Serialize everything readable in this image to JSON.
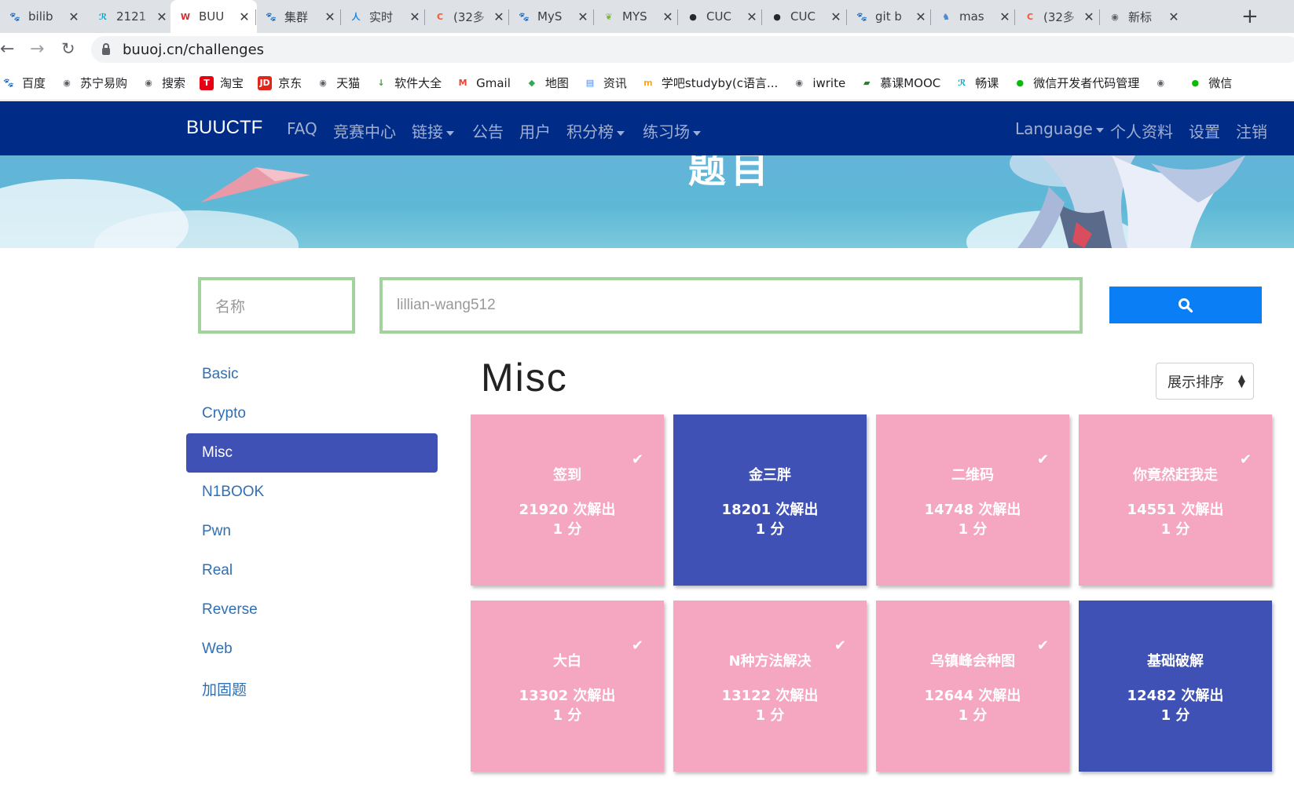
{
  "browser": {
    "tabs": [
      {
        "title": "bilib",
        "icon": "baidu-icon",
        "color": "#2932e1",
        "glyph": "🐾"
      },
      {
        "title": "2121",
        "icon": "runner-icon",
        "color": "#00a3c4",
        "glyph": "ℛ"
      },
      {
        "title": "BUU",
        "icon": "buuctf-icon",
        "color": "#d32f2f",
        "glyph": "W"
      },
      {
        "title": "集群",
        "icon": "baidu-icon",
        "color": "#2932e1",
        "glyph": "🐾"
      },
      {
        "title": "实时",
        "icon": "renren-icon",
        "color": "#1e88e5",
        "glyph": "人"
      },
      {
        "title": "(32多",
        "icon": "csdn-icon",
        "color": "#fc5531",
        "glyph": "C"
      },
      {
        "title": "MyS",
        "icon": "baidu-icon",
        "color": "#2932e1",
        "glyph": "🐾"
      },
      {
        "title": "MYS",
        "icon": "leaf-icon",
        "color": "#7cb342",
        "glyph": "❦"
      },
      {
        "title": "CUC",
        "icon": "github-icon",
        "color": "#24292e",
        "glyph": "●"
      },
      {
        "title": "CUC",
        "icon": "github-icon",
        "color": "#24292e",
        "glyph": "●"
      },
      {
        "title": "git b",
        "icon": "baidu-icon",
        "color": "#2932e1",
        "glyph": "🐾"
      },
      {
        "title": "mas",
        "icon": "elephant-icon",
        "color": "#4a86c5",
        "glyph": "♞"
      },
      {
        "title": "(32多",
        "icon": "csdn-icon",
        "color": "#fc5531",
        "glyph": "C"
      },
      {
        "title": "新标",
        "icon": "chrome-icon",
        "color": "#5f6368",
        "glyph": "◉"
      }
    ],
    "url": "buuoj.cn/challenges",
    "bookmarks": [
      {
        "label": "百度",
        "icon": "baidu-icon",
        "color": "#2932e1",
        "glyph": "🐾"
      },
      {
        "label": "苏宁易购",
        "icon": "globe-icon",
        "color": "#5f6368",
        "glyph": "◉"
      },
      {
        "label": "搜索",
        "icon": "globe-icon",
        "color": "#5f6368",
        "glyph": "◉"
      },
      {
        "label": "淘宝",
        "icon": "tmall-icon",
        "color": "#e60012",
        "glyph": "T"
      },
      {
        "label": "京东",
        "icon": "jd-icon",
        "color": "#e1251b",
        "glyph": "JD"
      },
      {
        "label": "天猫",
        "icon": "globe-icon",
        "color": "#5f6368",
        "glyph": "◉"
      },
      {
        "label": "软件大全",
        "icon": "download-icon",
        "color": "#43a047",
        "glyph": "↓"
      },
      {
        "label": "Gmail",
        "icon": "gmail-icon",
        "color": "#ffffff",
        "glyph": "M"
      },
      {
        "label": "地图",
        "icon": "maps-icon",
        "color": "#34a853",
        "glyph": "◆"
      },
      {
        "label": "资讯",
        "icon": "news-icon",
        "color": "#4285f4",
        "glyph": "▤"
      },
      {
        "label": "学吧studyby(c语言...",
        "icon": "studyby-icon",
        "color": "#f9a825",
        "glyph": "m"
      },
      {
        "label": "iwrite",
        "icon": "globe-icon",
        "color": "#5f6368",
        "glyph": "◉"
      },
      {
        "label": "慕课MOOC",
        "icon": "mooc-icon",
        "color": "#2e7d32",
        "glyph": "▰"
      },
      {
        "label": "畅课",
        "icon": "runner-icon",
        "color": "#00a3c4",
        "glyph": "ℛ"
      },
      {
        "label": "微信开发者代码管理",
        "icon": "wechat-icon",
        "color": "#09bb07",
        "glyph": "●"
      },
      {
        "label": "",
        "icon": "globe-icon",
        "color": "#5f6368",
        "glyph": "◉"
      },
      {
        "label": "微信",
        "icon": "wechat-icon",
        "color": "#09bb07",
        "glyph": "●"
      }
    ]
  },
  "site": {
    "brand": "BUUCTF",
    "nav": [
      "FAQ",
      "竞赛中心",
      "链接",
      "公告",
      "用户",
      "积分榜",
      "练习场"
    ],
    "nav_right": [
      "Language",
      "个人资料",
      "设置",
      "注销"
    ],
    "hero_title": "题目",
    "search": {
      "name_placeholder": "名称",
      "user_value": "lillian-wang512"
    },
    "categories": [
      "Basic",
      "Crypto",
      "Misc",
      "N1BOOK",
      "Pwn",
      "Real",
      "Reverse",
      "Web",
      "加固题"
    ],
    "active_category": "Misc",
    "category_title": "Misc",
    "sort_label": "展示排序",
    "colors": {
      "solved": "#f5a6c1",
      "unsolved": "#3f51b5",
      "nav": "#002b86",
      "search": "#0a7ff5"
    },
    "challenges": [
      {
        "name": "签到",
        "solves": "21920 次解出",
        "points": "1 分",
        "solved": true
      },
      {
        "name": "金三胖",
        "solves": "18201 次解出",
        "points": "1 分",
        "solved": false
      },
      {
        "name": "二维码",
        "solves": "14748 次解出",
        "points": "1 分",
        "solved": true
      },
      {
        "name": "你竟然赶我走",
        "solves": "14551 次解出",
        "points": "1 分",
        "solved": true
      },
      {
        "name": "大白",
        "solves": "13302 次解出",
        "points": "1 分",
        "solved": true
      },
      {
        "name": "N种方法解决",
        "solves": "13122 次解出",
        "points": "1 分",
        "solved": true
      },
      {
        "name": "乌镇峰会种图",
        "solves": "12644 次解出",
        "points": "1 分",
        "solved": true
      },
      {
        "name": "基础破解",
        "solves": "12482 次解出",
        "points": "1 分",
        "solved": false
      }
    ]
  }
}
